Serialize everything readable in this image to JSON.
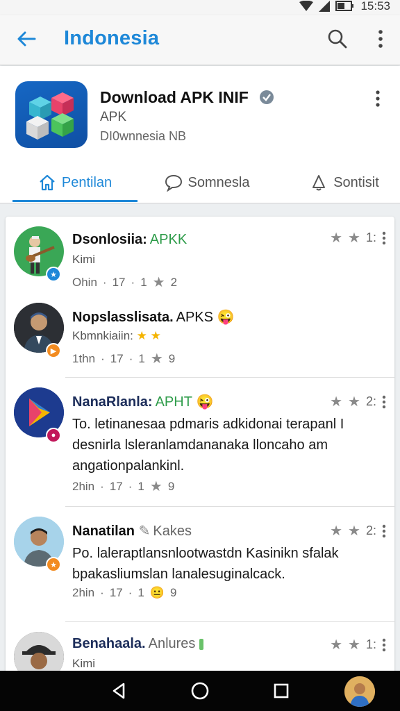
{
  "status_bar": {
    "time": "15:53"
  },
  "app_bar": {
    "title": "Indonesia"
  },
  "app": {
    "name": "Download APK INIF",
    "subtitle": "APK",
    "developer": "DI0wnnesia NB"
  },
  "tabs": [
    {
      "label": "Pentilan",
      "icon": "home-icon",
      "active": true
    },
    {
      "label": "Somnesla",
      "icon": "chat-bubble-icon",
      "active": false
    },
    {
      "label": "Sontisit",
      "icon": "bell-icon",
      "active": false
    }
  ],
  "posts": [
    {
      "title": "Dsonlosiia:",
      "tag": "APKK",
      "tag_color": "#2e9c4a",
      "sub": "Kimi",
      "time": "Ohin",
      "likes": "17",
      "count": "1",
      "reacts": "2",
      "rating": "1:"
    },
    {
      "title": "Nopslasslisata.",
      "tag": "APKS",
      "tag_color": "#111111",
      "sub": "Kbmnkiaiin:",
      "time": "1thn",
      "likes": "17",
      "count": "1",
      "reacts": "9",
      "rating": ""
    },
    {
      "title": "NanaRlanla:",
      "tag": "APHT",
      "tag_color": "#2e9c4a",
      "body": "To. letinanesaa pdmaris adkidonai terapanl I desnirla lsleranlamdananaka lloncaho am angationpalankinl.",
      "time": "2hin",
      "likes": "17",
      "count": "1",
      "reacts": "9",
      "rating": "2:"
    },
    {
      "title": "Nanatilan",
      "tag": "Kakes",
      "tag_color": "#666666",
      "body": "Po. laleraptlansnlootwastdn Kasinikn sfalak bpakasliumslan lanalesuginalcack.",
      "time": "2hin",
      "likes": "17",
      "count": "1",
      "reacts": "9",
      "rating": "2:"
    },
    {
      "title": "Benahaala.",
      "tag": "Anlures",
      "tag_color": "#666666",
      "sub": "Kimi",
      "rating": "1:"
    }
  ],
  "colors": {
    "accent": "#1e88d8",
    "tag_green": "#2e9c4a",
    "star": "#f4b400"
  }
}
